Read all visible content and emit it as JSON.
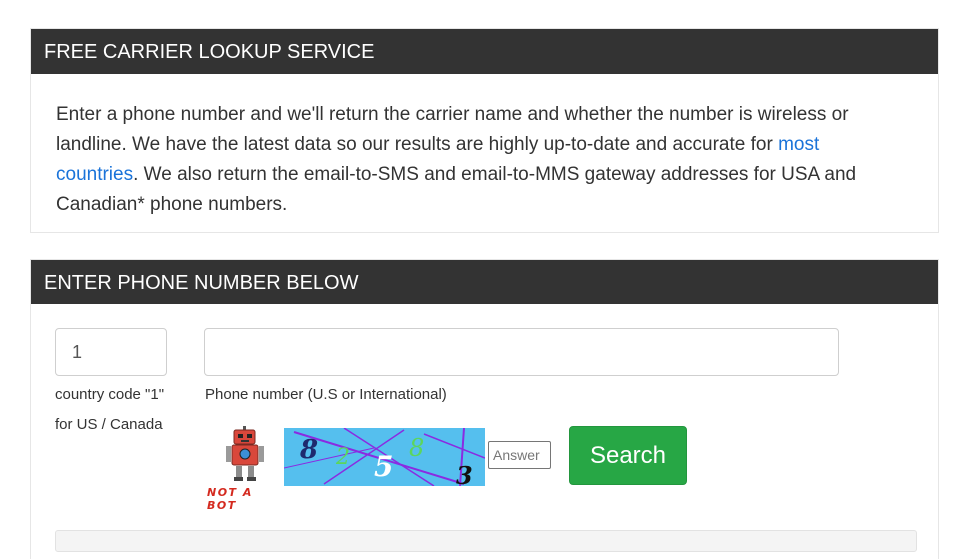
{
  "lookup_panel": {
    "title": "FREE CARRIER LOOKUP SERVICE",
    "intro_before_link": "Enter a phone number and we'll return the carrier name and whether the number is wireless or landline. We have the latest data so our results are highly up-to-date and accurate for ",
    "intro_link": "most countries",
    "intro_after_link": ". We also return the email-to-SMS and email-to-MMS gateway addresses for USA and Canadian* phone numbers."
  },
  "form_panel": {
    "title": "ENTER PHONE NUMBER BELOW",
    "country_code_value": "1",
    "country_code_help": "country code \"1\" for US / Canada",
    "phone_value": "",
    "phone_help": "Phone number (U.S or International)",
    "robot_label": "NOT A BOT",
    "captcha_chars": [
      "8",
      "2",
      "5",
      "8",
      "3"
    ],
    "answer_placeholder": "Answer",
    "search_label": "Search"
  },
  "colors": {
    "header_bg": "#333333",
    "link": "#1a73d9",
    "search_button": "#27a745",
    "captcha_bg": "#3fb6ec",
    "robot_red": "#d42a1f"
  },
  "icons": [
    "robot-icon",
    "captcha-image"
  ]
}
